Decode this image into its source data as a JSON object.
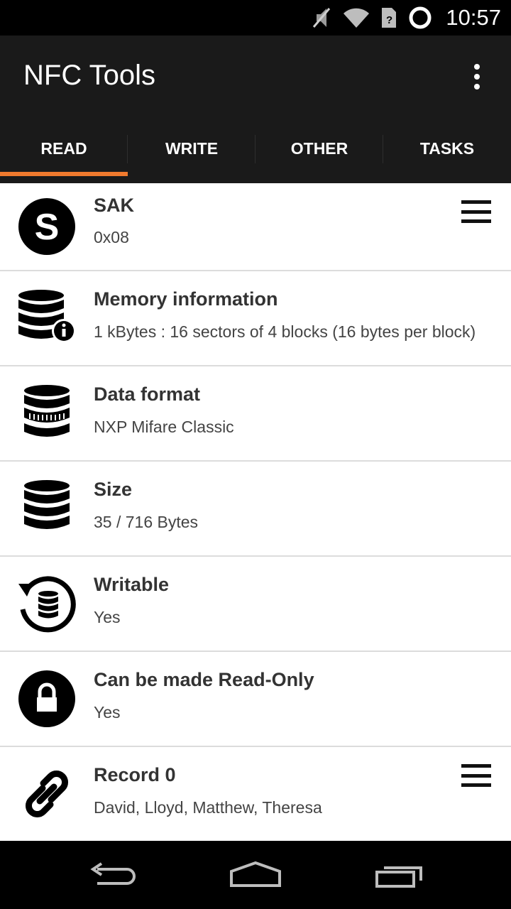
{
  "status_bar": {
    "time": "10:57",
    "icons": [
      "mute-icon",
      "wifi-icon",
      "no-sim-icon",
      "battery-charging-icon"
    ]
  },
  "app_bar": {
    "title": "NFC Tools",
    "overflow_icon": "more-vert-icon"
  },
  "tabs": [
    {
      "label": "READ",
      "active": true
    },
    {
      "label": "WRITE",
      "active": false
    },
    {
      "label": "OTHER",
      "active": false
    },
    {
      "label": "TASKS",
      "active": false
    }
  ],
  "colors": {
    "accent": "#f07a2e",
    "app_bar_bg": "#1a1a1a",
    "status_bar_bg": "#000000"
  },
  "rows": [
    {
      "icon": "s-circle-icon",
      "title": "SAK",
      "value": "0x08",
      "has_menu": true
    },
    {
      "icon": "database-info-icon",
      "title": "Memory information",
      "value": "1 kBytes : 16 sectors of 4 blocks (16 bytes per block)",
      "has_menu": false
    },
    {
      "icon": "data-format-icon",
      "title": "Data format",
      "value": "NXP Mifare Classic",
      "has_menu": false
    },
    {
      "icon": "database-icon",
      "title": "Size",
      "value": "35 / 716 Bytes",
      "has_menu": false
    },
    {
      "icon": "rewrite-database-icon",
      "title": "Writable",
      "value": "Yes",
      "has_menu": false
    },
    {
      "icon": "lock-circle-icon",
      "title": "Can be made Read-Only",
      "value": "Yes",
      "has_menu": false
    },
    {
      "icon": "link-icon",
      "title": "Record 0",
      "value": "David, Lloyd, Matthew, Theresa",
      "has_menu": true
    }
  ],
  "nav_bar": {
    "buttons": [
      "back-icon",
      "home-icon",
      "recents-icon"
    ]
  }
}
